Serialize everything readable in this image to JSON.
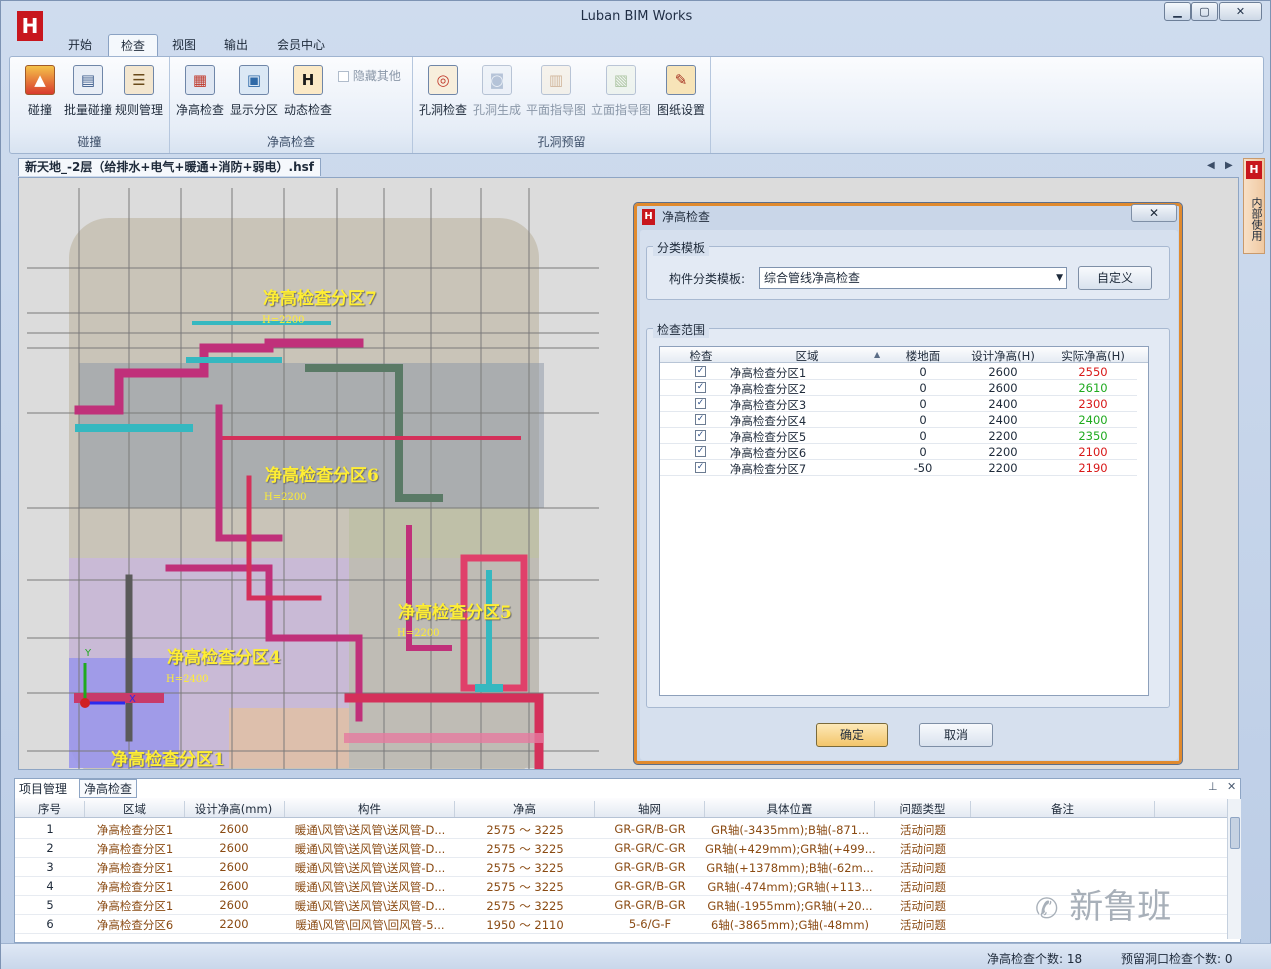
{
  "app": {
    "title": "Luban BIM Works",
    "logo_text": "H"
  },
  "menu": {
    "tabs": [
      "开始",
      "检查",
      "视图",
      "输出",
      "会员中心"
    ],
    "active": "检查"
  },
  "ribbon": {
    "groups": [
      {
        "label": "碰撞",
        "buttons": [
          "碰撞",
          "批量碰撞",
          "规则管理"
        ]
      },
      {
        "label": "净高检查",
        "buttons": [
          "净高检查",
          "显示分区",
          "动态检查"
        ],
        "checkbox": "隐藏其他"
      },
      {
        "label": "孔洞预留",
        "buttons": [
          "孔洞检查",
          "孔洞生成",
          "平面指导图",
          "立面指导图",
          "图纸设置"
        ]
      }
    ]
  },
  "document": {
    "tab": "新天地_-2层（给排水+电气+暖通+消防+弱电）.hsf"
  },
  "side_panel": {
    "label": "内部使用"
  },
  "canvas": {
    "zones": [
      {
        "label": "净高检查分区7",
        "height": "H=2200"
      },
      {
        "label": "净高检查分区6",
        "height": "H=2200"
      },
      {
        "label": "净高检查分区5",
        "height": "H=2200"
      },
      {
        "label": "净高检查分区4",
        "height": "H=2400"
      },
      {
        "label": "净高检查分区1",
        "height": ""
      }
    ],
    "axis": {
      "y": "Y",
      "x": "X"
    }
  },
  "dialog": {
    "title": "净高检查",
    "close": "✕",
    "template_group": "分类模板",
    "template_label": "构件分类模板:",
    "template_value": "综合管线净高检查",
    "customize": "自定义",
    "range_group": "检查范围",
    "columns": [
      "检查",
      "区域",
      "楼地面",
      "设计净高(H)",
      "实际净高(H)"
    ],
    "rows": [
      {
        "zone": "净高检查分区1",
        "floor": "0",
        "design": "2600",
        "actual": "2550",
        "ok": false
      },
      {
        "zone": "净高检查分区2",
        "floor": "0",
        "design": "2600",
        "actual": "2610",
        "ok": true
      },
      {
        "zone": "净高检查分区3",
        "floor": "0",
        "design": "2400",
        "actual": "2300",
        "ok": false
      },
      {
        "zone": "净高检查分区4",
        "floor": "0",
        "design": "2400",
        "actual": "2400",
        "ok": true
      },
      {
        "zone": "净高检查分区5",
        "floor": "0",
        "design": "2200",
        "actual": "2350",
        "ok": true
      },
      {
        "zone": "净高检查分区6",
        "floor": "0",
        "design": "2200",
        "actual": "2100",
        "ok": false
      },
      {
        "zone": "净高检查分区7",
        "floor": "-50",
        "design": "2200",
        "actual": "2190",
        "ok": false
      }
    ],
    "ok": "确定",
    "cancel": "取消"
  },
  "bottom": {
    "tabs": [
      "项目管理",
      "净高检查"
    ],
    "active": "净高检查",
    "columns": [
      "序号",
      "区域",
      "设计净高(mm)",
      "构件",
      "净高",
      "轴网",
      "具体位置",
      "问题类型",
      "备注"
    ],
    "rows": [
      [
        "1",
        "净高检查分区1",
        "2600",
        "暖通\\风管\\送风管\\送风管-D...",
        "2575 ～ 3225",
        "GR-GR/B-GR",
        "GR轴(-3435mm);B轴(-871...",
        "活动问题",
        ""
      ],
      [
        "2",
        "净高检查分区1",
        "2600",
        "暖通\\风管\\送风管\\送风管-D...",
        "2575 ～ 3225",
        "GR-GR/C-GR",
        "GR轴(+429mm);GR轴(+499...",
        "活动问题",
        ""
      ],
      [
        "3",
        "净高检查分区1",
        "2600",
        "暖通\\风管\\送风管\\送风管-D...",
        "2575 ～ 3225",
        "GR-GR/B-GR",
        "GR轴(+1378mm);B轴(-62m...",
        "活动问题",
        ""
      ],
      [
        "4",
        "净高检查分区1",
        "2600",
        "暖通\\风管\\送风管\\送风管-D...",
        "2575 ～ 3225",
        "GR-GR/B-GR",
        "GR轴(-474mm);GR轴(+113...",
        "活动问题",
        ""
      ],
      [
        "5",
        "净高检查分区1",
        "2600",
        "暖通\\风管\\送风管\\送风管-D...",
        "2575 ～ 3225",
        "GR-GR/B-GR",
        "GR轴(-1955mm);GR轴(+20...",
        "活动问题",
        ""
      ],
      [
        "6",
        "净高检查分区6",
        "2200",
        "暖通\\风管\\回风管\\回风管-5...",
        "1950 ～ 2110",
        "5-6/G-F",
        "6轴(-3865mm);G轴(-48mm)",
        "活动问题",
        ""
      ]
    ]
  },
  "status": {
    "clearance_count": "净高检查个数: 18",
    "hole_count": "预留洞口检查个数: 0"
  },
  "watermark": "新鲁班",
  "colors": {
    "ok": "#1faa1f",
    "fail": "#d81818",
    "accent": "#e08a2e",
    "zone_label": "#ffee33"
  }
}
